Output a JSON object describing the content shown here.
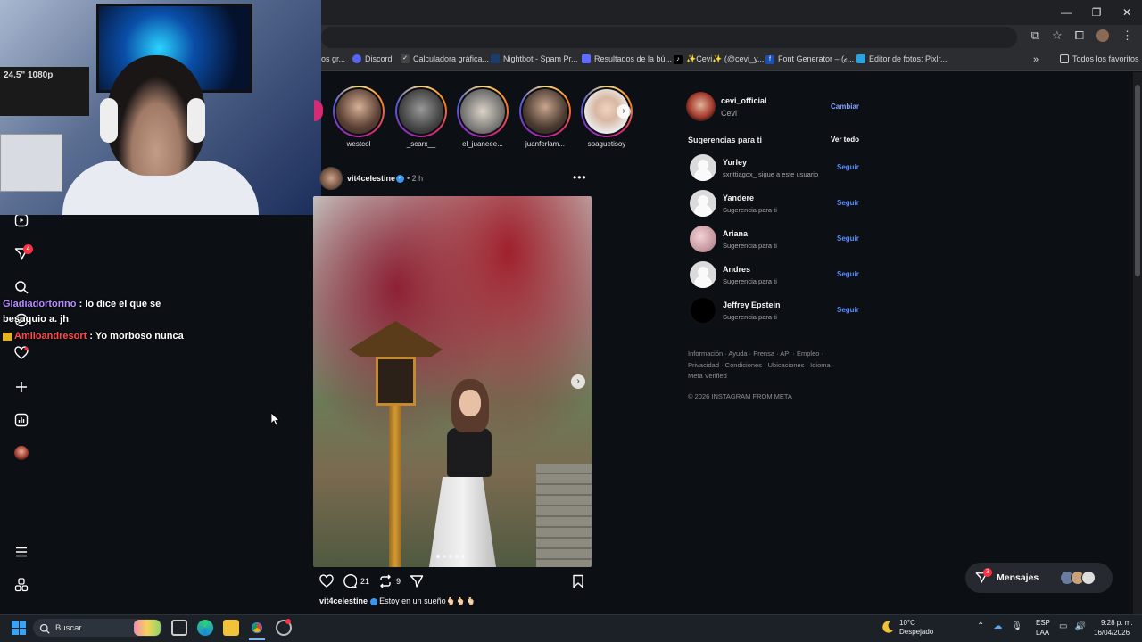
{
  "bookmarks": {
    "items": [
      {
        "label": "os gr..."
      },
      {
        "label": "Discord"
      },
      {
        "label": "Calculadora gráfica..."
      },
      {
        "label": "Nightbot - Spam Pr..."
      },
      {
        "label": "Resultados de la bú..."
      },
      {
        "label": "✨Cevi✨ (@cevi_y..."
      },
      {
        "label": "Font Generator – (𝒸..."
      },
      {
        "label": "Editor de fotos: Pixlr..."
      }
    ],
    "more": "»",
    "all_favorites": "Todos los favoritos"
  },
  "webcam": {
    "label": "24.5\" 1080p"
  },
  "nav": {
    "notifications_badge": "4"
  },
  "chat": [
    {
      "user": "Gladiadortorino",
      "message": ": lo dice el que se besuquio a. jh"
    },
    {
      "user": "Amiloandresort",
      "message": ": Yo morboso nunca"
    }
  ],
  "stories": [
    {
      "name": "westcol"
    },
    {
      "name": "_scarx__"
    },
    {
      "name": "el_juaneee..."
    },
    {
      "name": "juanferlam..."
    },
    {
      "name": "spaguetisoy"
    }
  ],
  "post": {
    "username": "vit4celestine",
    "verified": "✓",
    "time": "• 2 h",
    "more": "•••",
    "comments": "21",
    "reposts": "9",
    "caption_user": "vit4celestine",
    "caption_text": "Estoy en un sueño🫰🏻🫰🏻🫰🏻"
  },
  "profile": {
    "username": "cevi_official",
    "name": "Cevi",
    "switch_label": "Cambiar"
  },
  "suggestions": {
    "title": "Sugerencias para ti",
    "see_all": "Ver todo",
    "follow_label": "Seguir",
    "items": [
      {
        "username": "Yurley",
        "subtitle": "sxnttiagox_ sigue a este usuario"
      },
      {
        "username": "Yandere",
        "subtitle": "Sugerencia para ti"
      },
      {
        "username": "Ariana",
        "subtitle": "Sugerencia para ti"
      },
      {
        "username": "Andres",
        "subtitle": "Sugerencia para ti"
      },
      {
        "username": "Jeffrey Epstein",
        "subtitle": "Sugerencia para ti"
      }
    ]
  },
  "footer": {
    "links": "Información · Ayuda · Prensa · API · Empleo · Privacidad · Condiciones · Ubicaciones · Idioma · Meta Verified",
    "copyright": "© 2026 INSTAGRAM FROM META"
  },
  "messages": {
    "label": "Mensajes",
    "badge": "3"
  },
  "taskbar": {
    "search_placeholder": "Buscar",
    "weather_temp": "10°C",
    "weather_desc": "Despejado",
    "lang_line1": "ESP",
    "lang_line2": "LAA",
    "time": "9:28 p. m.",
    "date": "16/04/2026"
  },
  "colors": {
    "accent_link": "#5c8dff",
    "badge_red": "#ff3040",
    "verified_blue": "#3897f0"
  }
}
